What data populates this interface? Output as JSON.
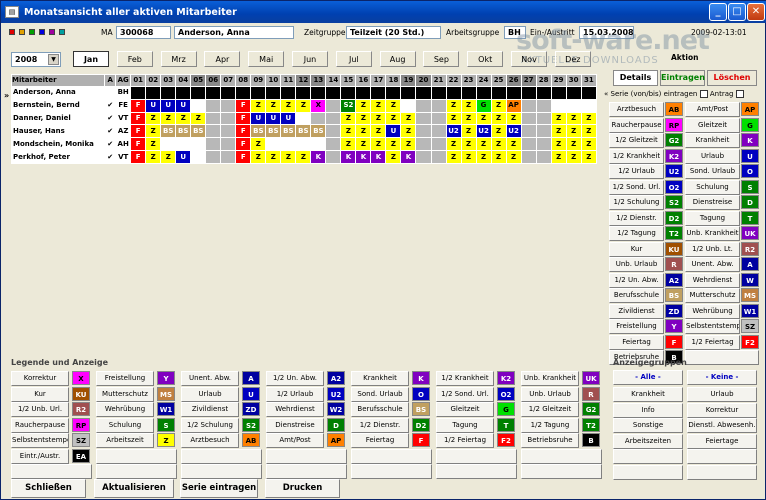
{
  "window": {
    "title": "Monatsansicht aller aktiven Mitarbeiter",
    "icon": "app-icon"
  },
  "header": {
    "ma_label": "MA",
    "ma_value": "300068",
    "name_value": "Anderson, Anna",
    "zeitgruppe_label": "Zeitgruppe",
    "zeitgruppe_value": "Teilzeit (20 Std.)",
    "arbeitsgruppe_label": "Arbeitsgruppe",
    "arbeitsgruppe_value": "BH",
    "einaus_label": "Ein-/Austritt",
    "einaus_value": "15.03.2008",
    "date_value": "2009-02-13:01",
    "colors": [
      "#e00000",
      "#e0a000",
      "#00a000",
      "#0000e0",
      "#a000a0",
      "#00a0a0"
    ]
  },
  "watermark": {
    "text": "soft-ware.net",
    "sub": "AKTUELLE DOWNLOADS"
  },
  "year": {
    "value": "2008"
  },
  "months": [
    "Jan",
    "Feb",
    "Mrz",
    "Apr",
    "Mai",
    "Jun",
    "Jul",
    "Aug",
    "Sep",
    "Okt",
    "Nov",
    "Dez"
  ],
  "selected_month": "Jan",
  "aktion_label": "Aktion",
  "tabs": {
    "details": "Details",
    "eintragen": "Eintragen",
    "loeschen": "Löschen"
  },
  "serie_label": "Serie (von/bis) eintragen",
  "antrag_label": "Antrag",
  "grid": {
    "col_mitarbeiter": "Mitarbeiter",
    "col_a": "A",
    "col_ag": "AG",
    "days": [
      "01",
      "02",
      "03",
      "04",
      "05",
      "06",
      "07",
      "08",
      "09",
      "10",
      "11",
      "12",
      "13",
      "14",
      "15",
      "16",
      "17",
      "18",
      "19",
      "20",
      "21",
      "22",
      "23",
      "24",
      "25",
      "26",
      "27",
      "28",
      "29",
      "30",
      "31"
    ],
    "weekend": [
      5,
      6,
      12,
      13,
      19,
      20,
      26,
      27
    ],
    "rows": [
      {
        "name": "Anderson, Anna",
        "check": "",
        "ag": "BH",
        "cells": [
          "blk",
          "blk",
          "blk",
          "blk",
          "blk",
          "blk",
          "blk",
          "blk",
          "blk",
          "blk",
          "blk",
          "blk",
          "blk",
          "blk",
          "blk",
          "blk",
          "blk",
          "blk",
          "blk",
          "blk",
          "blk",
          "blk",
          "blk",
          "blk",
          "blk",
          "blk",
          "blk",
          "blk",
          "blk",
          "blk",
          "blk"
        ]
      },
      {
        "name": "Bernstein, Bernd",
        "check": "✔",
        "ag": "FE",
        "cells": [
          "F",
          "U",
          "U",
          "U",
          "",
          "we",
          "we",
          "F",
          "Z",
          "Z",
          "Z",
          "Z",
          "X",
          "we",
          "S2",
          "Z",
          "Z",
          "Z",
          "",
          "we",
          "we",
          "Z",
          "Z",
          "G",
          "Z",
          "AP",
          "we",
          "we",
          "",
          "",
          "blank"
        ]
      },
      {
        "name": "Danner, Daniel",
        "check": "✔",
        "ag": "VT",
        "cells": [
          "F",
          "Z",
          "Z",
          "Z",
          "Z",
          "we",
          "we",
          "F",
          "U",
          "U",
          "U",
          "",
          "we",
          "we",
          "Z",
          "Z",
          "Z",
          "Z",
          "Z",
          "we",
          "we",
          "Z",
          "Z",
          "Z",
          "Z",
          "Z",
          "we",
          "we",
          "Z",
          "Z",
          "Z"
        ]
      },
      {
        "name": "Hauser, Hans",
        "check": "✔",
        "ag": "AZ",
        "cells": [
          "F",
          "Z",
          "BS",
          "BS",
          "BS",
          "we",
          "we",
          "F",
          "BS",
          "BS",
          "BS",
          "BS",
          "BS",
          "we",
          "Z",
          "Z",
          "Z",
          "U",
          "Z",
          "we",
          "we",
          "U2",
          "Z",
          "U2",
          "Z",
          "U2",
          "we",
          "we",
          "Z",
          "Z",
          "Z"
        ]
      },
      {
        "name": "Mondschein, Monika",
        "check": "✔",
        "ag": "AH",
        "cells": [
          "F",
          "Z",
          "",
          "",
          "",
          "we",
          "we",
          "F",
          "Z",
          "",
          "",
          "",
          "",
          "we",
          "Z",
          "Z",
          "Z",
          "Z",
          "Z",
          "we",
          "we",
          "Z",
          "Z",
          "Z",
          "Z",
          "Z",
          "we",
          "we",
          "Z",
          "Z",
          "Z"
        ]
      },
      {
        "name": "Perkhof, Peter",
        "check": "✔",
        "ag": "VT",
        "cells": [
          "F",
          "Z",
          "Z",
          "U",
          "",
          "we",
          "we",
          "F",
          "Z",
          "Z",
          "Z",
          "Z",
          "K",
          "we",
          "K",
          "K",
          "K",
          "Z",
          "K",
          "we",
          "we",
          "Z",
          "Z",
          "Z",
          "Z",
          "Z",
          "we",
          "we",
          "Z",
          "Z",
          "Z"
        ]
      }
    ]
  },
  "right_panel": [
    [
      "Arztbesuch",
      "AB",
      "Amt/Post",
      "AP"
    ],
    [
      "Raucherpause",
      "RP",
      "Gleitzeit",
      "G"
    ],
    [
      "1/2 Gleitzeit",
      "G2",
      "Krankheit",
      "K"
    ],
    [
      "1/2 Krankheit",
      "K2",
      "Urlaub",
      "U"
    ],
    [
      "1/2 Urlaub",
      "U2",
      "Sond. Urlaub",
      "O"
    ],
    [
      "1/2 Sond. Url.",
      "O2",
      "Schulung",
      "S"
    ],
    [
      "1/2 Schulung",
      "S2",
      "Dienstreise",
      "D"
    ],
    [
      "1/2 Dienstr.",
      "D2",
      "Tagung",
      "T"
    ],
    [
      "1/2 Tagung",
      "T2",
      "Unb. Krankheit",
      "UK"
    ],
    [
      "Kur",
      "KU",
      "1/2 Unb. Lt.",
      "R2"
    ],
    [
      "Unb. Urlaub",
      "R",
      "Unent. Abw.",
      "A"
    ],
    [
      "1/2 Un. Abw.",
      "A2",
      "Wehrdienst",
      "W"
    ],
    [
      "Berufsschule",
      "BS",
      "Mutterschutz",
      "MS"
    ],
    [
      "Zivildienst",
      "ZD",
      "Wehrübung",
      "W1"
    ],
    [
      "Freistellung",
      "Y",
      "Selbstentstempel",
      "SZ"
    ],
    [
      "Feiertag",
      "F",
      "1/2 Feiertag",
      "F2"
    ],
    [
      "Betriebsruhe",
      "B",
      "",
      ""
    ]
  ],
  "chip_colors": {
    "AB": "#ff8000",
    "AP": "#ff8000",
    "RP": "#ff00ff",
    "G": "#00e000",
    "G2": "#008000",
    "K": "#8000c0",
    "K2": "#8000c0",
    "U": "#0000c0",
    "U2": "#0000c0",
    "O": "#0000c0",
    "O2": "#0000c0",
    "S": "#008000",
    "S2": "#008000",
    "D": "#008000",
    "D2": "#008000",
    "T": "#008000",
    "T2": "#008000",
    "UK": "#8000c0",
    "KU": "#a05000",
    "R2": "#a05050",
    "R": "#a05050",
    "A": "#0000a0",
    "A2": "#0000a0",
    "W": "#0000a0",
    "BS": "#c0a060",
    "MS": "#c08040",
    "ZD": "#0000a0",
    "W1": "#0000a0",
    "Y": "#8000c0",
    "SZ": "#c0c0c0",
    "F": "#ff0000",
    "F2": "#ff0000",
    "B": "#000000",
    "X": "#ff00ff",
    "EA": "#000000"
  },
  "legend": {
    "title": "Legende und Anzeige",
    "columns": [
      [
        [
          "Korrektur",
          "X"
        ],
        [
          "Kur",
          "KU"
        ],
        [
          "1/2 Unb. Url.",
          "R2"
        ],
        [
          "Raucherpause",
          "RP"
        ],
        [
          "Selbstentstempel",
          "SZ"
        ],
        [
          "Eintr./Austr.",
          "EA"
        ]
      ],
      [
        [
          "Freistellung",
          "Y"
        ],
        [
          "Mutterschutz",
          "MS"
        ],
        [
          "Wehrübung",
          "W1"
        ],
        [
          "Schulung",
          "S"
        ],
        [
          "Arbeitszeit",
          "Z"
        ]
      ],
      [
        [
          "Unent. Abw.",
          "A"
        ],
        [
          "Urlaub",
          "U"
        ],
        [
          "Zivildienst",
          "ZD"
        ],
        [
          "1/2 Schulung",
          "S2"
        ],
        [
          "Arztbesuch",
          "AB"
        ]
      ],
      [
        [
          "1/2 Un. Abw.",
          "A2"
        ],
        [
          "1/2 Urlaub",
          "U2"
        ],
        [
          "Wehrdienst",
          "W2"
        ],
        [
          "Dienstreise",
          "D"
        ],
        [
          "Amt/Post",
          "AP"
        ]
      ],
      [
        [
          "Krankheit",
          "K"
        ],
        [
          "Sond. Urlaub",
          "O"
        ],
        [
          "Berufsschule",
          "BS"
        ],
        [
          "1/2 Dienstr.",
          "D2"
        ],
        [
          "Feiertag",
          "F"
        ]
      ],
      [
        [
          "1/2 Krankheit",
          "K2"
        ],
        [
          "1/2 Sond. Url.",
          "O2"
        ],
        [
          "Gleitzeit",
          "G"
        ],
        [
          "Tagung",
          "T"
        ],
        [
          "1/2 Feiertag",
          "F2"
        ]
      ],
      [
        [
          "Unb. Krankheit",
          "UK"
        ],
        [
          "Unb. Urlaub",
          "R"
        ],
        [
          "1/2 Gleitzeit",
          "G2"
        ],
        [
          "1/2 Tagung",
          "T2"
        ],
        [
          "Betriebsruhe",
          "B"
        ]
      ]
    ]
  },
  "anzeige": {
    "title": "Anzeigegruppen",
    "alle": "- Alle -",
    "keine": "- Keine -",
    "items": [
      [
        "Krankheit",
        "Urlaub"
      ],
      [
        "Info",
        "Korrektur"
      ],
      [
        "Sonstige",
        "Dienstl. Abwesenh."
      ],
      [
        "Arbeitszeiten",
        "Feiertage"
      ]
    ]
  },
  "footer": {
    "schliessen": "Schließen",
    "aktualisieren": "Aktualisieren",
    "serie": "Serie eintragen",
    "drucken": "Drucken"
  }
}
